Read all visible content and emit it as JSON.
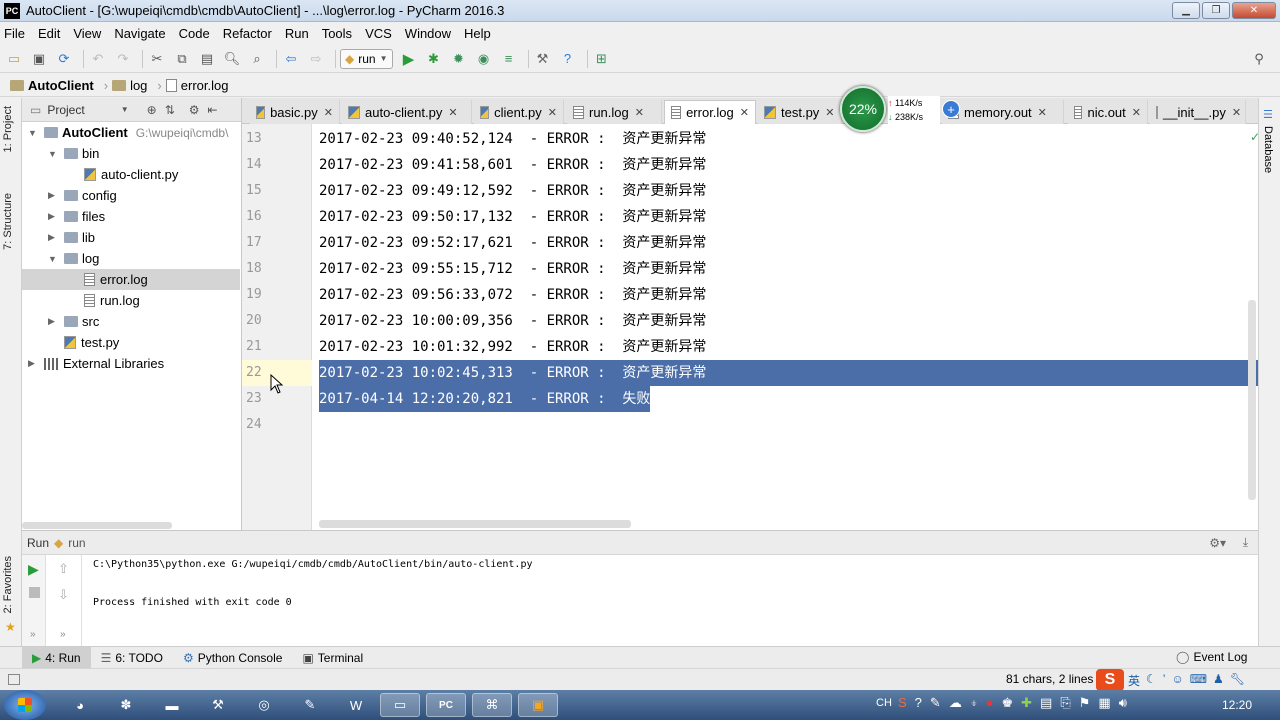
{
  "window": {
    "title": "AutoClient - [G:\\wupeiqi\\cmdb\\cmdb\\AutoClient] - ...\\log\\error.log - PyCharm 2016.3",
    "app_icon_text": "PC"
  },
  "menu": [
    "File",
    "Edit",
    "View",
    "Navigate",
    "Code",
    "Refactor",
    "Run",
    "Tools",
    "VCS",
    "Window",
    "Help"
  ],
  "toolbar": {
    "run_config": "run"
  },
  "breadcrumb": [
    "AutoClient",
    "log",
    "error.log"
  ],
  "left_strip": {
    "project_tab": "1: Project",
    "structure_tab": "7: Structure",
    "favorites_tab": "2: Favorites"
  },
  "right_strip": {
    "database_tab": "Database"
  },
  "project_panel": {
    "header": "Project",
    "tree": [
      {
        "label": "AutoClient",
        "hint": "G:\\wupeiqi\\cmdb\\",
        "indent": 0,
        "type": "folder",
        "expanded": true
      },
      {
        "label": "bin",
        "indent": 1,
        "type": "folder",
        "expanded": true
      },
      {
        "label": "auto-client.py",
        "indent": 2,
        "type": "py"
      },
      {
        "label": "config",
        "indent": 1,
        "type": "folder",
        "expanded": false
      },
      {
        "label": "files",
        "indent": 1,
        "type": "folder",
        "expanded": false
      },
      {
        "label": "lib",
        "indent": 1,
        "type": "folder",
        "expanded": false
      },
      {
        "label": "log",
        "indent": 1,
        "type": "folder",
        "expanded": true
      },
      {
        "label": "error.log",
        "indent": 2,
        "type": "log",
        "selected": true
      },
      {
        "label": "run.log",
        "indent": 2,
        "type": "log"
      },
      {
        "label": "src",
        "indent": 1,
        "type": "folder",
        "expanded": false
      },
      {
        "label": "test.py",
        "indent": 1,
        "type": "py"
      },
      {
        "label": "External Libraries",
        "indent": 0,
        "type": "lib",
        "expanded": false
      }
    ]
  },
  "tabs": [
    {
      "label": "basic.py",
      "active": false
    },
    {
      "label": "auto-client.py",
      "active": false
    },
    {
      "label": "client.py",
      "active": false
    },
    {
      "label": "run.log",
      "active": false
    },
    {
      "label": "error.log",
      "active": true
    },
    {
      "label": "test.py",
      "active": false
    },
    {
      "label": "memory.out",
      "active": false
    },
    {
      "label": "nic.out",
      "active": false
    },
    {
      "label": "__init__.py",
      "active": false
    }
  ],
  "editor": {
    "lines": [
      {
        "num": "13",
        "text": "2017-02-23 09:40:52,124  - ERROR :  资产更新异常"
      },
      {
        "num": "14",
        "text": "2017-02-23 09:41:58,601  - ERROR :  资产更新异常"
      },
      {
        "num": "15",
        "text": "2017-02-23 09:49:12,592  - ERROR :  资产更新异常"
      },
      {
        "num": "16",
        "text": "2017-02-23 09:50:17,132  - ERROR :  资产更新异常"
      },
      {
        "num": "17",
        "text": "2017-02-23 09:52:17,621  - ERROR :  资产更新异常"
      },
      {
        "num": "18",
        "text": "2017-02-23 09:55:15,712  - ERROR :  资产更新异常"
      },
      {
        "num": "19",
        "text": "2017-02-23 09:56:33,072  - ERROR :  资产更新异常"
      },
      {
        "num": "20",
        "text": "2017-02-23 10:00:09,356  - ERROR :  资产更新异常"
      },
      {
        "num": "21",
        "text": "2017-02-23 10:01:32,992  - ERROR :  资产更新异常"
      },
      {
        "num": "22",
        "text": "2017-02-23 10:02:45,313  - ERROR :  资产更新异常",
        "selected": "full"
      },
      {
        "num": "23",
        "text": "2017-04-14 12:20:20,821  - ERROR :  失败",
        "selected": "partial"
      },
      {
        "num": "24",
        "text": ""
      }
    ]
  },
  "net_widget": {
    "percent": "22%",
    "up": "114K/s",
    "down": "238K/s"
  },
  "run_panel": {
    "title": "Run",
    "config": "run",
    "console": [
      "C:\\Python35\\python.exe G:/wupeiqi/cmdb/cmdb/AutoClient/bin/auto-client.py",
      "",
      "Process finished with exit code 0"
    ]
  },
  "tool_tabs": [
    {
      "label": "4: Run",
      "icon": "run-icon",
      "active": true
    },
    {
      "label": "6: TODO",
      "icon": "todo-icon",
      "active": false
    },
    {
      "label": "Python Console",
      "icon": "python-console-icon",
      "active": false
    },
    {
      "label": "Terminal",
      "icon": "terminal-icon",
      "active": false
    }
  ],
  "event_log": "Event Log",
  "status": {
    "selection": "81 chars, 2 lines"
  },
  "taskbar": {
    "clock": "12:20",
    "lang": "CH",
    "ime": "英",
    "apps": [
      "firefox-like",
      "paint",
      "save",
      "tools",
      "chrome",
      "notepad",
      "word",
      "explorer",
      "pycharm",
      "network",
      "app"
    ]
  }
}
